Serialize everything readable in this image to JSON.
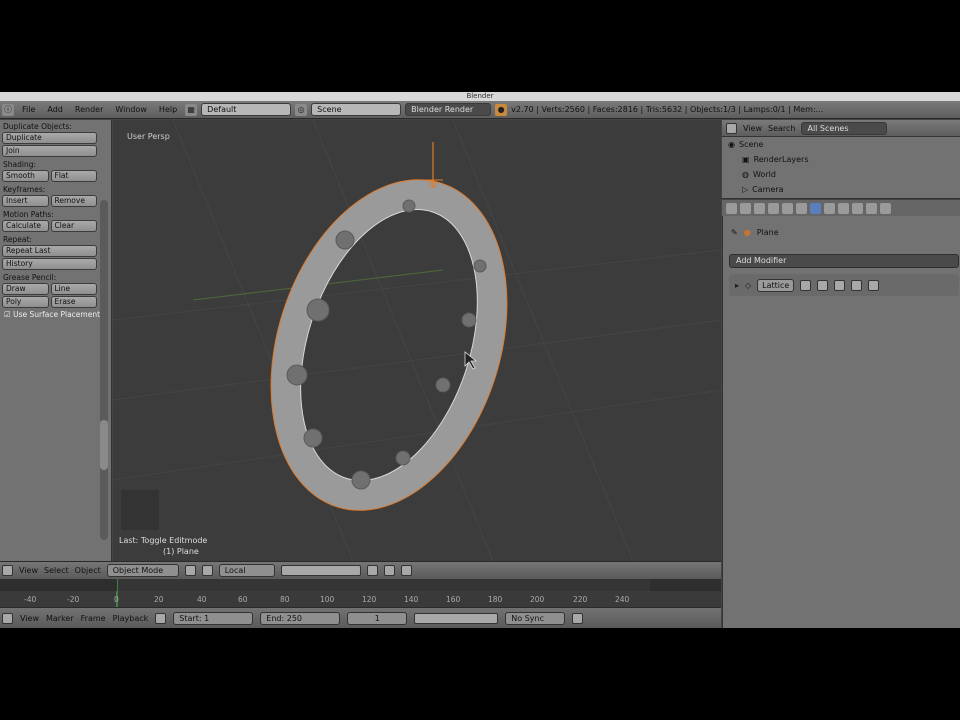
{
  "window": {
    "title": "Blender"
  },
  "infobar": {
    "menus": [
      "File",
      "Add",
      "Render",
      "Window",
      "Help"
    ],
    "layout_field": "Default",
    "scene_field": "Scene",
    "engine": "Blender Render",
    "stats": "v2.70 | Verts:2560 | Faces:2816 | Tris:5632 | Objects:1/3 | Lamps:0/1 | Mem:..."
  },
  "toolshelf": {
    "duplicate_heading": "Duplicate Objects:",
    "duplicate_btn": "Duplicate",
    "join_btn": "Join",
    "shading_heading": "Shading:",
    "smooth_btn": "Smooth",
    "flat_btn": "Flat",
    "keyframes_heading": "Keyframes:",
    "insert_btn": "Insert",
    "remove_btn": "Remove",
    "motion_heading": "Motion Paths:",
    "calculate_btn": "Calculate",
    "clear_btn": "Clear",
    "repeat_heading": "Repeat:",
    "repeat_last_btn": "Repeat Last",
    "history_btn": "History",
    "grease_heading": "Grease Pencil:",
    "draw_btn": "Draw",
    "line_btn": "Line",
    "poly_btn": "Poly",
    "erase_btn": "Erase",
    "surface_check": "Use Surface Placement"
  },
  "viewport": {
    "label": "User Persp",
    "last_op": "Last: Toggle Editmode",
    "obj_name": "(1) Plane"
  },
  "view3d_header": {
    "view": "View",
    "select": "Select",
    "object": "Object",
    "mode": "Object Mode",
    "orientation": "Local"
  },
  "timeline": {
    "ticks": [
      "-40",
      "-20",
      "0",
      "20",
      "40",
      "60",
      "80",
      "100",
      "120",
      "140",
      "160",
      "180",
      "200",
      "220",
      "240"
    ],
    "menus": [
      "View",
      "Marker",
      "Frame",
      "Playback"
    ],
    "start": "Start: 1",
    "end": "End: 250",
    "current": "1",
    "sync": "No Sync"
  },
  "outliner": {
    "view": "View",
    "search": "Search",
    "all_scenes": "All Scenes",
    "rows": [
      "Scene",
      "RenderLayers",
      "World",
      "Camera"
    ]
  },
  "properties": {
    "object_name": "Plane",
    "add_modifier": "Add Modifier",
    "modifier_name": "Lattice"
  },
  "colors": {
    "wire": "#e07b2a",
    "ring_surface": "#8f8f8f",
    "grid": "#4a4a4a"
  }
}
